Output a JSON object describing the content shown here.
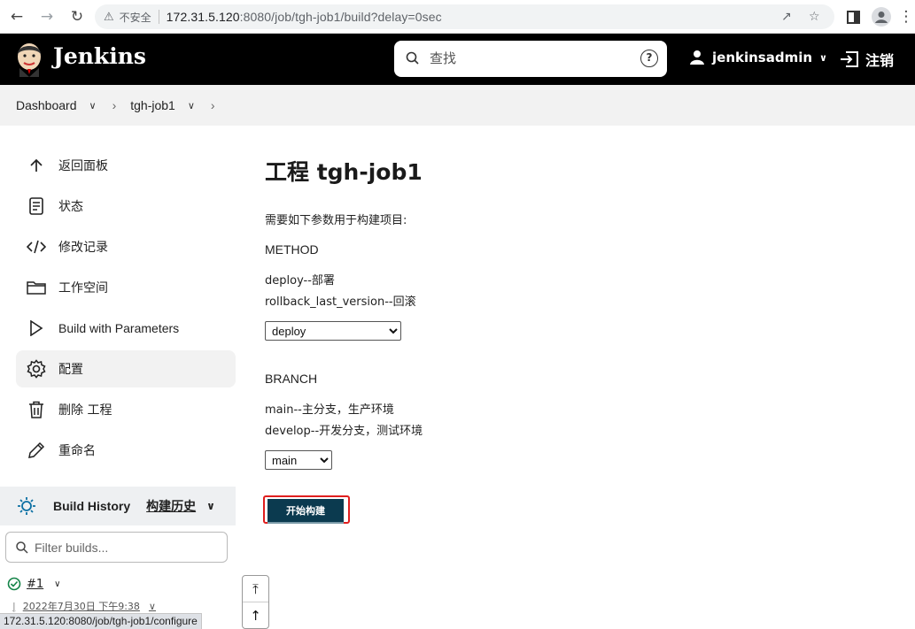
{
  "browser": {
    "security_label": "不安全",
    "url_host": "172.31.5.120",
    "url_rest": ":8080/job/tgh-job1/build?delay=0sec",
    "icons": [
      "back-arrow-icon",
      "forward-arrow-icon",
      "reload-icon",
      "warning-icon",
      "share-icon",
      "star-icon",
      "sidebar-icon",
      "profile-icon",
      "menu-icon"
    ]
  },
  "header": {
    "brand": "Jenkins",
    "search_placeholder": "查找",
    "help_symbol": "?",
    "username": "jenkinsadmin",
    "logout_label": "注销"
  },
  "breadcrumbs": {
    "items": [
      "Dashboard",
      "tgh-job1"
    ]
  },
  "sidebar": {
    "tasks": [
      {
        "label": "返回面板",
        "icon": "arrow-up-icon"
      },
      {
        "label": "状态",
        "icon": "document-icon"
      },
      {
        "label": "修改记录",
        "icon": "code-icon"
      },
      {
        "label": "工作空间",
        "icon": "folder-icon"
      },
      {
        "label": "Build with Parameters",
        "icon": "play-icon"
      },
      {
        "label": "配置",
        "icon": "gear-icon"
      },
      {
        "label": "删除 工程",
        "icon": "trash-icon"
      },
      {
        "label": "重命名",
        "icon": "pencil-icon"
      }
    ],
    "active_task": "配置",
    "build_history": {
      "title": "Build History",
      "title_zh": "构建历史",
      "filter_placeholder": "Filter builds...",
      "builds": [
        {
          "number": "#1",
          "date": "2022年7月30日 下午9:38",
          "status": "success"
        }
      ]
    }
  },
  "status_bar_url": "172.31.5.120:8080/job/tgh-job1/configure",
  "main": {
    "title": "工程 tgh-job1",
    "intro": "需要如下参数用于构建项目:",
    "params": [
      {
        "name": "METHOD",
        "descriptions": [
          "deploy--部署",
          "rollback_last_version--回滚"
        ],
        "selected": "deploy"
      },
      {
        "name": "BRANCH",
        "descriptions": [
          "main--主分支，生产环境",
          "develop--开发分支，测试环境"
        ],
        "selected": "main"
      }
    ],
    "build_button": "开始构建"
  },
  "colors": {
    "header_bg": "#000000",
    "build_button_bg": "#0b3a4f",
    "highlight_border": "#e01e1e",
    "success": "#138347"
  }
}
